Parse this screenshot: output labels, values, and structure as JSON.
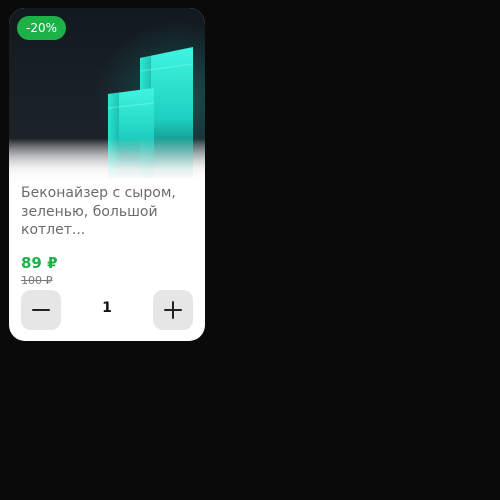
{
  "product": {
    "discount_badge": "-20%",
    "title": "Беконайзер с сыром, зеленью, большой котлет...",
    "price": "89 ₽",
    "old_price": "100 ₽",
    "quantity": "1"
  },
  "icons": {
    "image": "3d-bars-illustration",
    "decrease": "minus-icon",
    "increase": "plus-icon"
  },
  "colors": {
    "accent_green": "#1db247",
    "background": "#0a0a0a",
    "card": "#ffffff",
    "button_bg": "#e6e6e6",
    "bar_teal": "#2de8d2"
  }
}
